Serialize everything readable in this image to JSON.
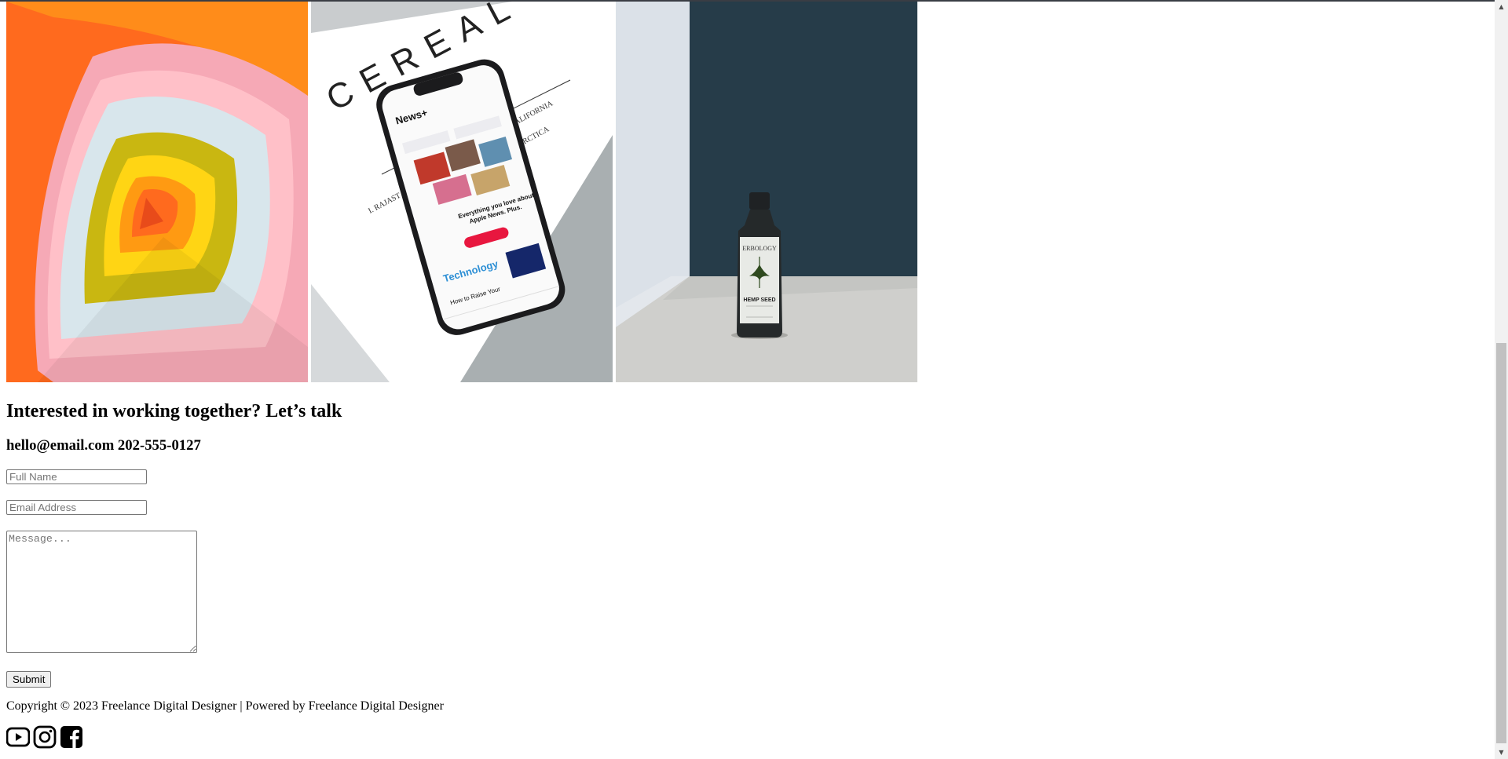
{
  "gallery": {
    "images": [
      {
        "name": "abstract-nested-shapes-image",
        "alt": ""
      },
      {
        "name": "phone-on-magazine-image",
        "alt": "",
        "magazine_word": "CEREAL",
        "phone_app": "News+",
        "phone_headline": "Technology"
      },
      {
        "name": "hemp-seed-bottle-image",
        "alt": "",
        "brand": "ERBOLOGY",
        "product": "HEMP SEED"
      }
    ]
  },
  "contact": {
    "heading": "Interested in working together? Let’s talk",
    "details": "hello@email.com 202-555-0127"
  },
  "form": {
    "name_placeholder": "Full Name",
    "email_placeholder": "Email Address",
    "message_placeholder": "Message...",
    "submit_label": "Submit"
  },
  "footer": {
    "copyright": "Copyright © 2023 Freelance Digital Designer | Powered by Freelance Digital Designer",
    "social": [
      {
        "icon": "youtube-icon"
      },
      {
        "icon": "instagram-icon"
      },
      {
        "icon": "facebook-icon"
      }
    ]
  },
  "colors": {
    "orange": "#ff5a1f",
    "navy_wall": "#263c49",
    "accent_red": "#e8173f"
  }
}
